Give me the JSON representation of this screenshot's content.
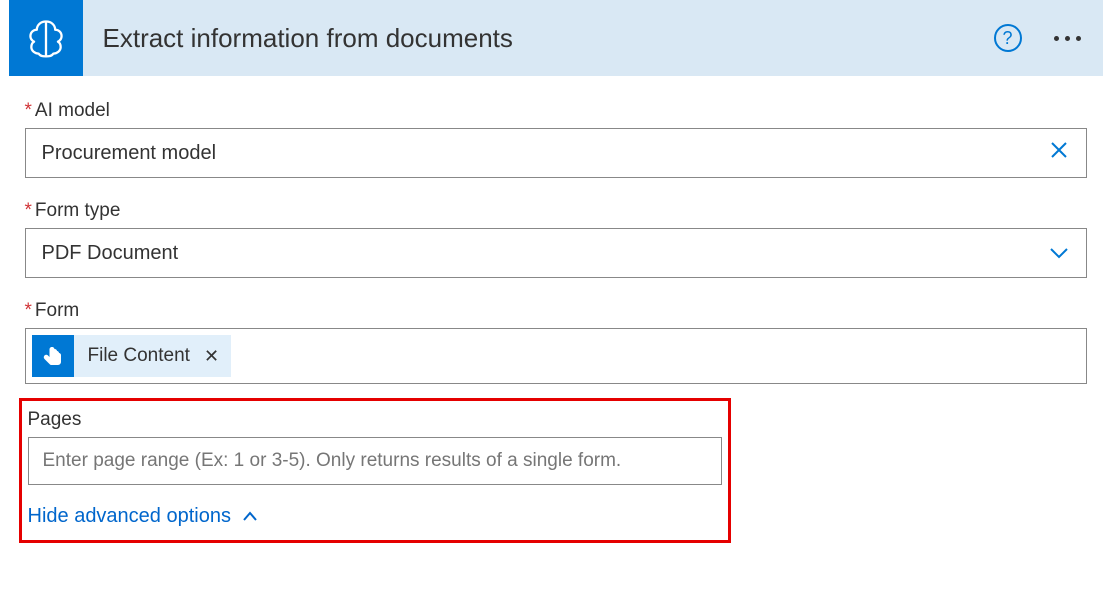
{
  "header": {
    "title": "Extract information from documents"
  },
  "fields": {
    "ai_model": {
      "label": "AI model",
      "value": "Procurement model"
    },
    "form_type": {
      "label": "Form type",
      "value": "PDF Document"
    },
    "form": {
      "label": "Form",
      "token_label": "File Content"
    },
    "pages": {
      "label": "Pages",
      "placeholder": "Enter page range (Ex: 1 or 3-5). Only returns results of a single form."
    }
  },
  "advanced_toggle": "Hide advanced options"
}
